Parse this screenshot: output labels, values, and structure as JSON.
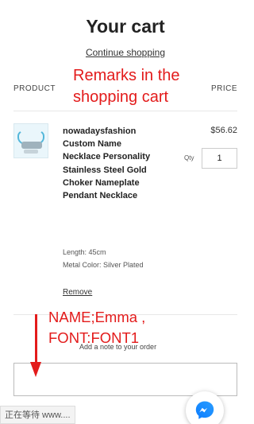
{
  "header": {
    "title": "Your cart",
    "continue_link": "Continue shopping"
  },
  "table": {
    "col_product": "PRODUCT",
    "col_price": "PRICE"
  },
  "annotations": {
    "remarks": "Remarks in the shopping cart",
    "personalization": "NAME;Emma , FONT:FONT1",
    "color": "#e31b1b"
  },
  "item": {
    "name": "nowadaysfashion Custom Name Necklace Personality Stainless Steel Gold Choker Nameplate Pendant Necklace",
    "length": "Length: 45cm",
    "metal": "Metal Color: Silver Plated",
    "remove_label": "Remove",
    "price": "$56.62",
    "qty_label": "Qty",
    "qty_value": "1"
  },
  "note": {
    "label": "Add a note to your order"
  },
  "status": {
    "loading_text": "正在等待 www...."
  },
  "icons": {
    "messenger": "messenger-icon",
    "arrow": "arrow-down-icon"
  }
}
